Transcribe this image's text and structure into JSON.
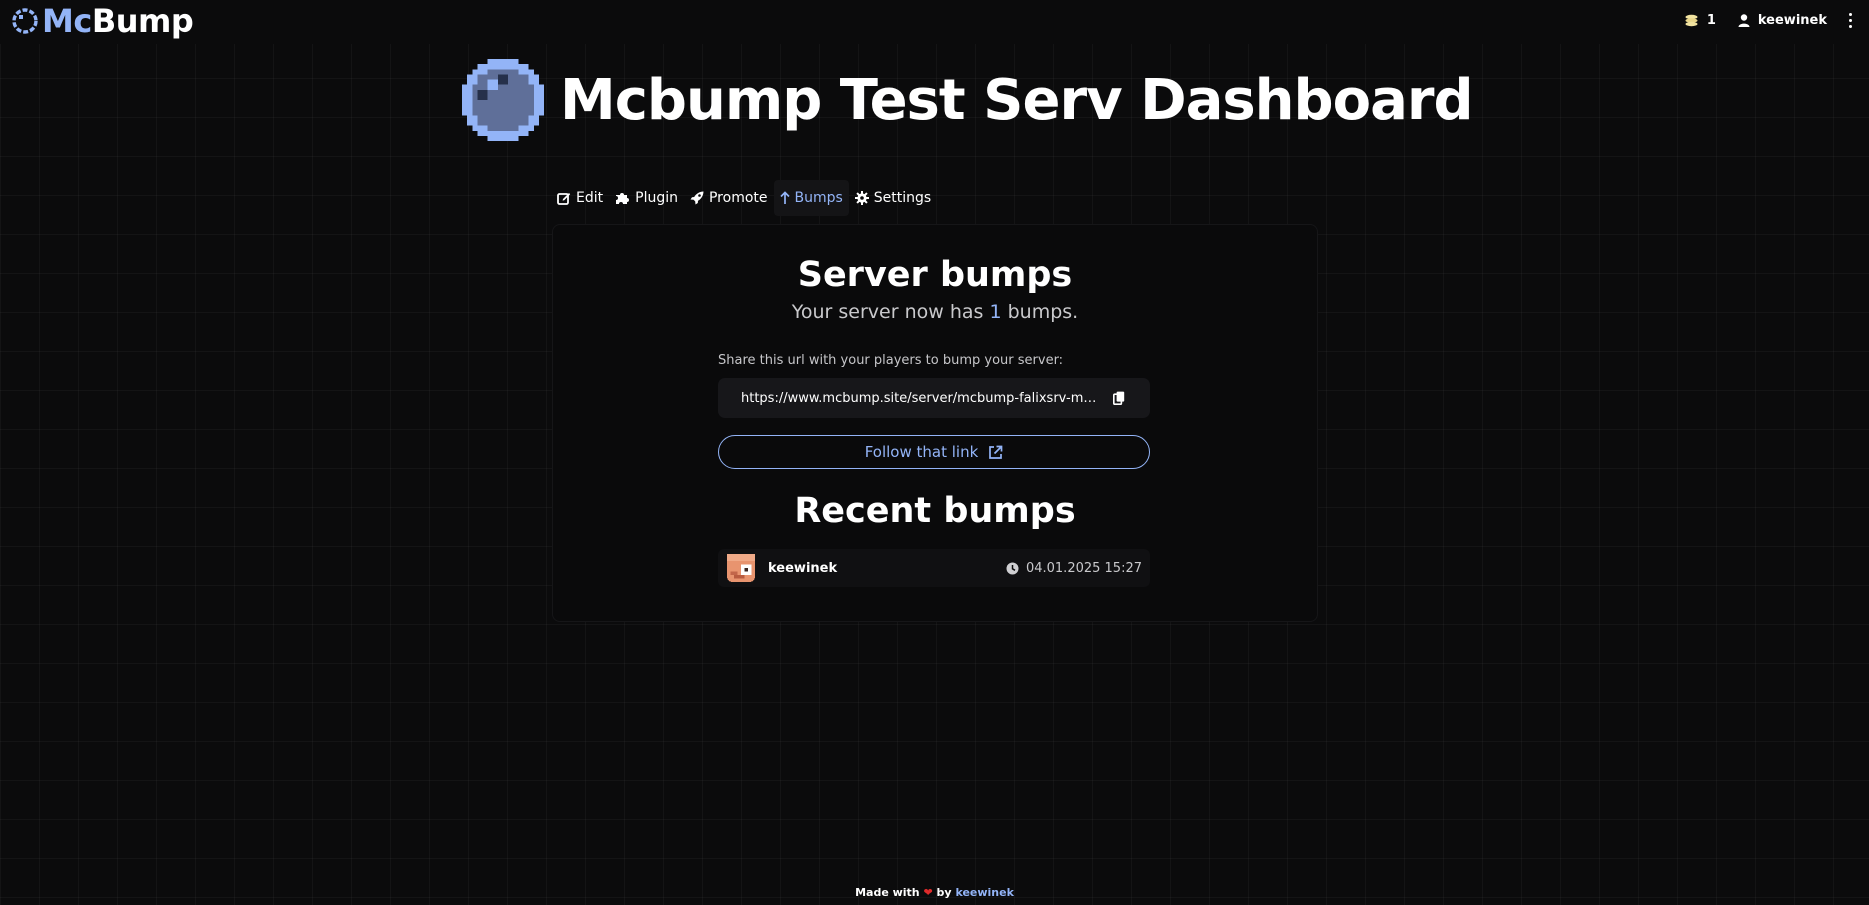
{
  "brand": {
    "part1": "Mc",
    "part2": "Bump",
    "logo_icon": "circle-logo-icon"
  },
  "nav": {
    "coins": "1",
    "username": "keewinek",
    "coin_icon": "coins-icon",
    "user_icon": "user-icon",
    "menu_icon": "kebab-menu-icon"
  },
  "page": {
    "title": "Mcbump Test Serv Dashboard",
    "server_icon": "pixel-orb-icon"
  },
  "tabs": [
    {
      "label": "Edit",
      "icon": "edit-icon"
    },
    {
      "label": "Plugin",
      "icon": "puzzle-icon"
    },
    {
      "label": "Promote",
      "icon": "rocket-icon"
    },
    {
      "label": "Bumps",
      "icon": "arrow-up-icon",
      "active": true
    },
    {
      "label": "Settings",
      "icon": "gear-icon"
    }
  ],
  "bumps": {
    "title": "Server bumps",
    "subtitle_prefix": "Your server now has ",
    "count": "1",
    "subtitle_suffix": " bumps.",
    "share_label": "Share this url with your players to bump your server:",
    "url": "https://www.mcbump.site/server/mcbump-falixsrv-me/bump",
    "follow_label": "Follow that link"
  },
  "recent": {
    "title": "Recent bumps",
    "items": [
      {
        "user": "keewinek",
        "time": "04.01.2025 15:27"
      }
    ]
  },
  "footer": {
    "made_with": "Made with",
    "by": "by",
    "author": "keewinek"
  },
  "colors": {
    "accent": "#93b4f7",
    "background": "#0b0b0c",
    "heart": "#e02b2b"
  }
}
